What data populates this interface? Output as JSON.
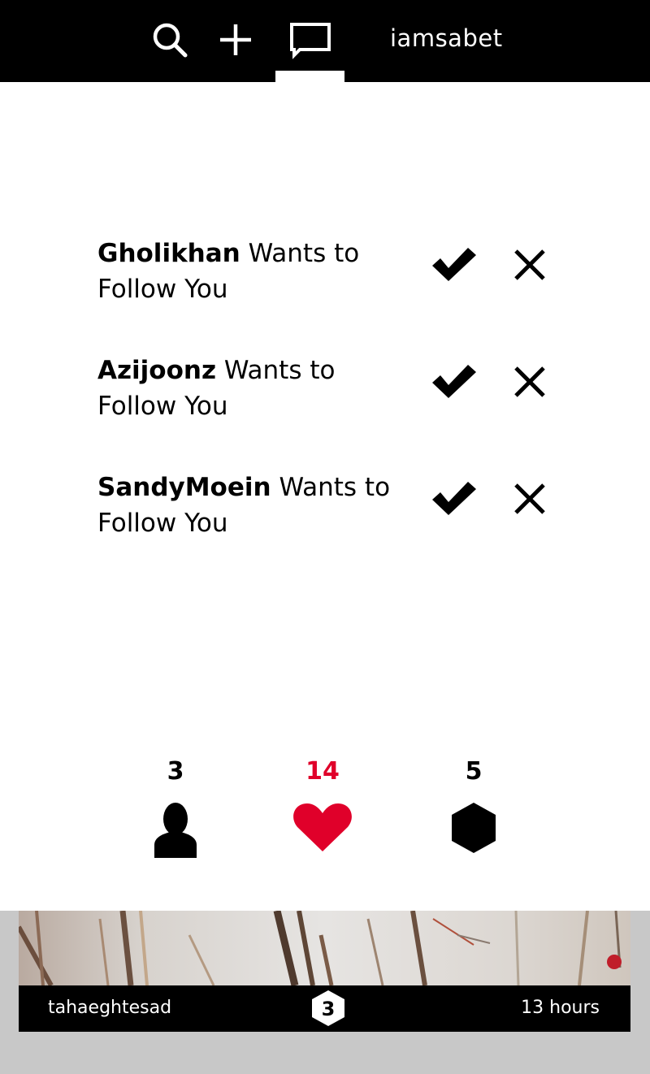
{
  "header": {
    "username": "iamsabet",
    "icons": [
      "search-icon",
      "plus-icon",
      "message-icon"
    ]
  },
  "requests": [
    {
      "user": "Gholikhan",
      "line1_rest": " Wants to",
      "line2": "Follow You"
    },
    {
      "user": "Azijoonz",
      "line1_rest": " Wants to",
      "line2": "Follow You"
    },
    {
      "user": "SandyMoein",
      "line1_rest": " Wants to",
      "line2": "Follow You"
    }
  ],
  "stats": {
    "followers": "3",
    "likes": "14",
    "posts": "5"
  },
  "feed": {
    "username": "tahaeghtesad",
    "badge": "3",
    "time": "13 hours"
  },
  "colors": {
    "accent": "#e0002a",
    "bar": "#000000",
    "feed_bg": "#c8c8c8"
  }
}
